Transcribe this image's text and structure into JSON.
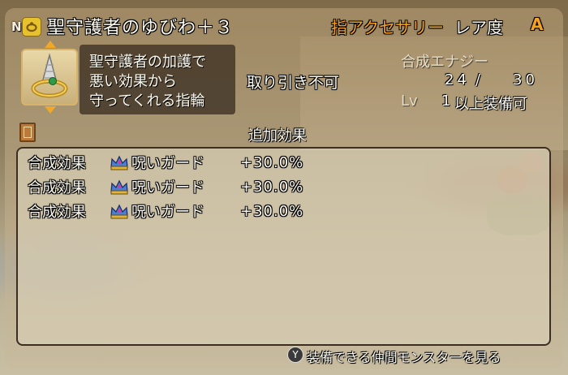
{
  "header": {
    "grade": "N",
    "category_icon": "ring-icon",
    "item_name": "聖守護者のゆびわ＋３",
    "item_type": "指アクセサリー",
    "rarity_label": "レア度",
    "rarity_value": "A"
  },
  "item": {
    "icon": "ring-icon",
    "description": [
      "聖守護者の加護で",
      "悪い効果から",
      "守ってくれる指輪"
    ],
    "trade_status": "取り引き不可"
  },
  "stats": {
    "energy_label": "合成エナジー",
    "energy_current": "24",
    "energy_separator": "/",
    "energy_max": "30",
    "level_label": "Lv",
    "level_value": "1",
    "level_suffix": "以上装備可"
  },
  "effects": {
    "section_icon": "book-icon",
    "title": "追加効果",
    "rows": [
      {
        "source": "合成効果",
        "icon": "crown-icon",
        "name": "呪いガード",
        "value": "+30.0%"
      },
      {
        "source": "合成効果",
        "icon": "crown-icon",
        "name": "呪いガード",
        "value": "+30.0%"
      },
      {
        "source": "合成効果",
        "icon": "crown-icon",
        "name": "呪いガード",
        "value": "+30.0%"
      }
    ]
  },
  "footer": {
    "button": "Y",
    "hint": "装備できる仲間モンスターを見る"
  },
  "colors": {
    "accent_orange": "#f5a21e",
    "text_white": "#fdfbf0",
    "panel_dark": "#3c302 3"
  }
}
